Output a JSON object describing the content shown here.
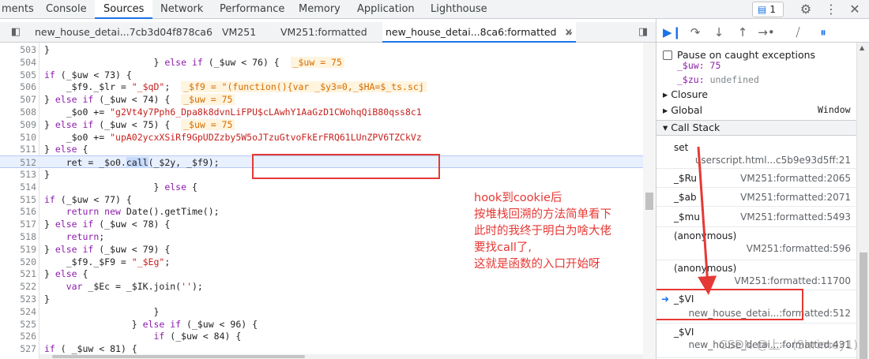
{
  "panel_tabs": [
    "ments",
    "Console",
    "Sources",
    "Network",
    "Performance",
    "Memory",
    "Application",
    "Lighthouse"
  ],
  "issues_badge": "1",
  "file_tabs": [
    "new_house_detai...7cb3d04f878ca6",
    "VM251",
    "VM251:formatted",
    "new_house_detai...8ca6:formatted"
  ],
  "more_tabs_glyph": "»",
  "code_lines": [
    {
      "ln": "503",
      "html": "                        }"
    },
    {
      "ln": "504",
      "html": "                    } <span class='kw'>else if</span> (_$uw < 76) {  <span class='inline-val'>_$uw = 75</span>"
    },
    {
      "ln": "505",
      "html": "                        <span class='kw'>if</span> (_$uw < 73) {"
    },
    {
      "ln": "506",
      "html": "                            _$f9._$lr = <span class='str'>\"_$qD\"</span>;  <span class='inline-val'>_$f9 = \"(function(){var _$y3=0,_$HA=$_ts.scj</span>"
    },
    {
      "ln": "507",
      "html": "                        } <span class='kw'>else if</span> (_$uw < 74) {  <span class='inline-val'>_$uw = 75</span>"
    },
    {
      "ln": "508",
      "html": "                            _$o0 += <span class='str'>\"g2Vt4y7Pph6_Dpa8k8dvnLiFPU$cLAwhY1AaGzD1CWohqQiB80qss8c1</span>"
    },
    {
      "ln": "509",
      "html": "                        } <span class='kw'>else if</span> (_$uw < 75) {  <span class='inline-val'>_$uw = 75</span>"
    },
    {
      "ln": "510",
      "html": "                            _$o0 += <span class='str'>\"upA02ycxXSiRf9GpUDZzby5W5oJTzuGtvoFkErFRQ61LUnZPV6TZCkVz</span>"
    },
    {
      "ln": "511",
      "html": "                        } <span class='kw'>else</span> {"
    },
    {
      "ln": "512",
      "html": "                            ret = _$o0.<span class='sel'>call</span>(_$2y, _$f9);",
      "current": true
    },
    {
      "ln": "513",
      "html": "                        }"
    },
    {
      "ln": "514",
      "html": "                    } <span class='kw'>else</span> {"
    },
    {
      "ln": "515",
      "html": "                        <span class='kw'>if</span> (_$uw < 77) {"
    },
    {
      "ln": "516",
      "html": "                            <span class='kw'>return new</span> Date().getTime();"
    },
    {
      "ln": "517",
      "html": "                        } <span class='kw'>else if</span> (_$uw < 78) {"
    },
    {
      "ln": "518",
      "html": "                            <span class='kw'>return</span>;"
    },
    {
      "ln": "519",
      "html": "                        } <span class='kw'>else if</span> (_$uw < 79) {"
    },
    {
      "ln": "520",
      "html": "                            _$f9._$F9 = <span class='str'>\"_$Eg\"</span>;"
    },
    {
      "ln": "521",
      "html": "                        } <span class='kw'>else</span> {"
    },
    {
      "ln": "522",
      "html": "                            <span class='kw'>var</span> _$Ec = _$IK.join(<span class='str'>''</span>);"
    },
    {
      "ln": "523",
      "html": "                        }"
    },
    {
      "ln": "524",
      "html": "                    }"
    },
    {
      "ln": "525",
      "html": "                } <span class='kw'>else if</span> (_$uw < 96) {"
    },
    {
      "ln": "526",
      "html": "                    <span class='kw'>if</span> (_$uw < 84) {"
    },
    {
      "ln": "527",
      "html": "                        <span class='kw'>if</span> ( _$uw < 81) {"
    }
  ],
  "annotation": "hook到cookie后\n按堆栈回溯的方法简单看下\n此时的我终于明白为啥大佬\n要找call了,\n这就是函数的入口开始呀",
  "debugger": {
    "pause_caught_label": "Pause on caught exceptions",
    "scope_uw": "_$uw: 75",
    "scope_zu_key": "_$zu:",
    "scope_zu_val": "undefined",
    "closure_label": "Closure",
    "global_label": "Global",
    "global_value": "Window",
    "call_stack_label": "Call Stack",
    "frames": [
      {
        "name": "set",
        "loc": "userscript.html...c5b9e93d5ff:21"
      },
      {
        "name": "_$Ru",
        "loc": "VM251:formatted:2065"
      },
      {
        "name": "_$ab",
        "loc": "VM251:formatted:2071"
      },
      {
        "name": "_$mu",
        "loc": "VM251:formatted:5493"
      },
      {
        "name": "(anonymous)",
        "loc": "VM251:formatted:596"
      },
      {
        "name": "(anonymous)",
        "loc": "VM251:formatted:11700"
      },
      {
        "name": "_$VI",
        "loc": "new_house_detai...:formatted:512"
      },
      {
        "name": "_$VI",
        "loc": "new_house_detai...:formatted:431"
      }
    ]
  },
  "watermark": "CSDN @上—(Shrimey1)",
  "colors": {
    "accent": "#1a73e8",
    "annotation": "#e53935"
  }
}
